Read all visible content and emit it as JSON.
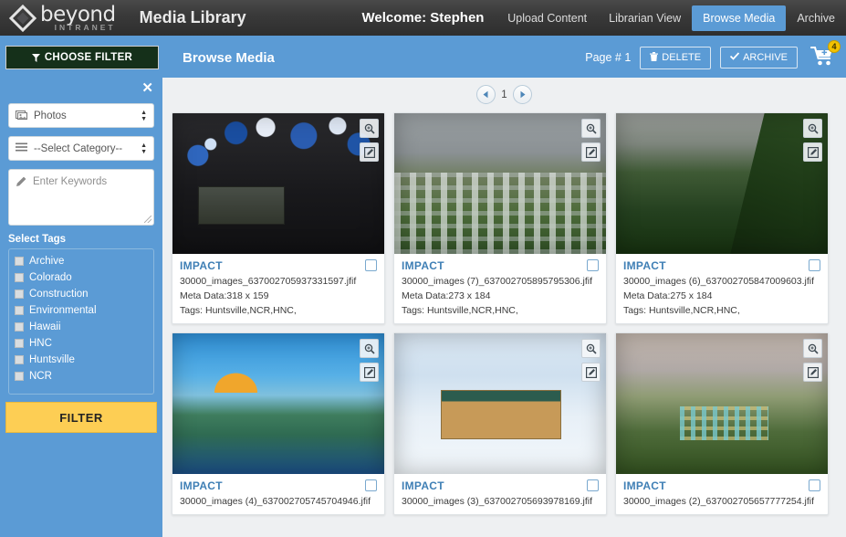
{
  "header": {
    "logo_main": "beyond",
    "logo_sub": "INTRANET",
    "logo_icon": "diamond-logo-icon",
    "app_title": "Media Library",
    "welcome": "Welcome: Stephen",
    "nav": [
      {
        "label": "Upload Content",
        "active": false
      },
      {
        "label": "Librarian View",
        "active": false
      },
      {
        "label": "Browse Media",
        "active": true
      },
      {
        "label": "Archive",
        "active": false
      }
    ],
    "accent_color": "#5b9bd5",
    "bar_color": "#333333"
  },
  "toolbar": {
    "choose_filter_label": "CHOOSE FILTER",
    "filter_icon": "funnel-icon",
    "section_title": "Browse Media",
    "page_label": "Page # 1",
    "delete_label": "DELETE",
    "delete_icon": "trash-icon",
    "archive_label": "ARCHIVE",
    "archive_icon": "check-icon",
    "cart_icon": "cart-plus-icon",
    "cart_count": "4",
    "cart_badge_color": "#f2c200"
  },
  "sidebar": {
    "close_icon": "close-icon",
    "media_type": {
      "icon": "photos-icon",
      "value": "Photos"
    },
    "category": {
      "icon": "list-icon",
      "value": "--Select Category--"
    },
    "keywords": {
      "icon": "pencil-icon",
      "placeholder": "Enter Keywords",
      "value": ""
    },
    "tags_label": "Select Tags",
    "tags": [
      {
        "label": "Archive",
        "checked": false
      },
      {
        "label": "Colorado",
        "checked": false
      },
      {
        "label": "Construction",
        "checked": false
      },
      {
        "label": "Environmental",
        "checked": false
      },
      {
        "label": "Hawaii",
        "checked": false
      },
      {
        "label": "HNC",
        "checked": false
      },
      {
        "label": "Huntsville",
        "checked": false
      },
      {
        "label": "NCR",
        "checked": false
      }
    ],
    "filter_button": "FILTER",
    "filter_button_color": "#fdce54",
    "panel_color": "#5b9bd5"
  },
  "pager": {
    "prev_icon": "chevron-left-icon",
    "next_icon": "chevron-right-icon",
    "current_page": "1"
  },
  "cards": [
    {
      "title": "IMPACT",
      "filename": "30000_images_637002705937331597.jfif",
      "meta": "Meta Data:318 x 159",
      "tags": "Tags: Huntsville,NCR,HNC,",
      "art": "art-balloons",
      "zoom_icon": "magnifier-icon",
      "edit_icon": "edit-pencil-icon",
      "checkbox": "select-checkbox"
    },
    {
      "title": "IMPACT",
      "filename": "30000_images (7)_637002705895795306.jfif",
      "meta": "Meta Data:273 x 184",
      "tags": "Tags: Huntsville,NCR,HNC,",
      "art": "art-hillvillage",
      "zoom_icon": "magnifier-icon",
      "edit_icon": "edit-pencil-icon",
      "checkbox": "select-checkbox"
    },
    {
      "title": "IMPACT",
      "filename": "30000_images (6)_637002705847009603.jfif",
      "meta": "Meta Data:275 x 184",
      "tags": "Tags: Huntsville,NCR,HNC,",
      "art": "art-greenvalley",
      "zoom_icon": "magnifier-icon",
      "edit_icon": "edit-pencil-icon",
      "checkbox": "select-checkbox"
    },
    {
      "title": "IMPACT",
      "filename": "30000_images (4)_637002705745704946.jfif",
      "meta": "",
      "tags": "",
      "art": "art-poolvilla",
      "zoom_icon": "magnifier-icon",
      "edit_icon": "edit-pencil-icon",
      "checkbox": "select-checkbox"
    },
    {
      "title": "IMPACT",
      "filename": "30000_images (3)_637002705693978169.jfif",
      "meta": "",
      "tags": "",
      "art": "art-snowhotel",
      "zoom_icon": "magnifier-icon",
      "edit_icon": "edit-pencil-icon",
      "checkbox": "select-checkbox"
    },
    {
      "title": "IMPACT",
      "filename": "30000_images (2)_637002705657777254.jfif",
      "meta": "",
      "tags": "",
      "art": "art-hilltown",
      "zoom_icon": "magnifier-icon",
      "edit_icon": "edit-pencil-icon",
      "checkbox": "select-checkbox"
    }
  ]
}
